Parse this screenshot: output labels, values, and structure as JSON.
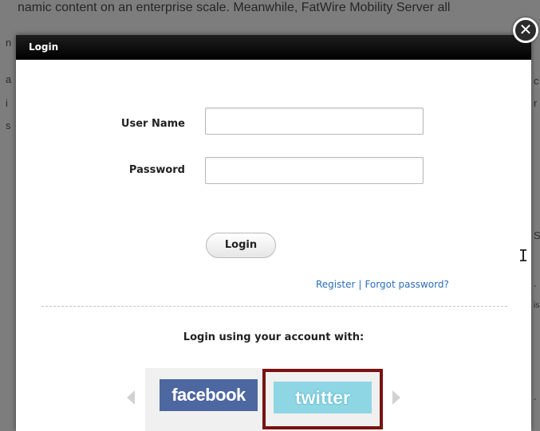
{
  "background": {
    "text_line": "namic content on an enterprise scale. Meanwhile, FatWire Mobility Server all",
    "fragments": [
      "n",
      "a",
      "i",
      "s",
      "c",
      "r",
      "Sc",
      "- ",
      "is",
      "- "
    ]
  },
  "dialog": {
    "title": "Login",
    "close_symbol": "✕",
    "form": {
      "username_label": "User Name",
      "username_value": "",
      "password_label": "Password",
      "password_value": "",
      "login_button": "Login"
    },
    "links": {
      "register": "Register",
      "separator": "|",
      "forgot": "Forgot password?"
    },
    "social": {
      "title": "Login using your account with:",
      "providers": [
        "facebook",
        "twitter"
      ],
      "selected": "twitter"
    }
  },
  "colors": {
    "header_bg": "#000000",
    "link": "#2a6ebb",
    "facebook": "#4d67a0",
    "twitter": "#8fd6e4",
    "selection_border": "#7b1010"
  },
  "icons": [
    "close-icon",
    "arrow-left-icon",
    "arrow-right-icon",
    "text-cursor-icon"
  ]
}
